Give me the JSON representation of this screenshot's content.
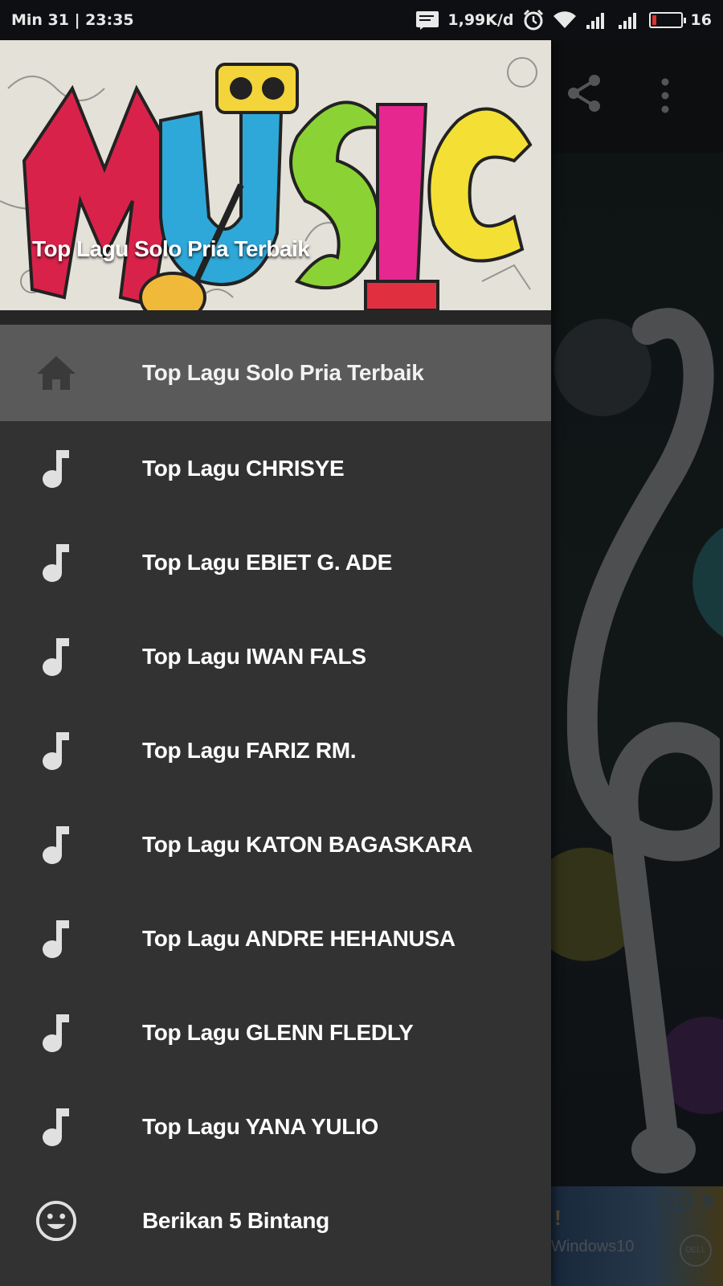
{
  "status_bar": {
    "datetime": "Min 31 | 23:35",
    "network_speed": "1,99K/d",
    "battery_level": "16",
    "icons": [
      "message-icon",
      "alarm-icon",
      "wifi-icon",
      "signal-icon",
      "signal-icon",
      "battery-icon"
    ]
  },
  "drawer": {
    "header_title": "Top Lagu Solo Pria Terbaik",
    "items": [
      {
        "label": "Top Lagu Solo Pria Terbaik",
        "icon": "home-icon",
        "active": true
      },
      {
        "label": "Top Lagu CHRISYE",
        "icon": "music-note-icon"
      },
      {
        "label": "Top Lagu EBIET G. ADE",
        "icon": "music-note-icon"
      },
      {
        "label": "Top Lagu IWAN FALS",
        "icon": "music-note-icon"
      },
      {
        "label": "Top Lagu FARIZ RM.",
        "icon": "music-note-icon"
      },
      {
        "label": "Top Lagu KATON BAGASKARA",
        "icon": "music-note-icon"
      },
      {
        "label": "Top Lagu ANDRE HEHANUSA",
        "icon": "music-note-icon"
      },
      {
        "label": "Top Lagu GLENN FLEDLY",
        "icon": "music-note-icon"
      },
      {
        "label": "Top Lagu YANA YULIO",
        "icon": "music-note-icon"
      },
      {
        "label": "Berikan 5 Bintang",
        "icon": "smiley-icon"
      }
    ]
  },
  "background": {
    "toolbar_icons": [
      "share-icon",
      "overflow-menu-icon"
    ],
    "ad": {
      "text": "Windows10",
      "brand": "DELL",
      "mark": "!"
    }
  },
  "colors": {
    "drawer_bg": "#323232",
    "active_item_bg": "#5a5a5a",
    "icon_color": "#e0e0e0",
    "statusbar_bg": "#0e0f12"
  }
}
